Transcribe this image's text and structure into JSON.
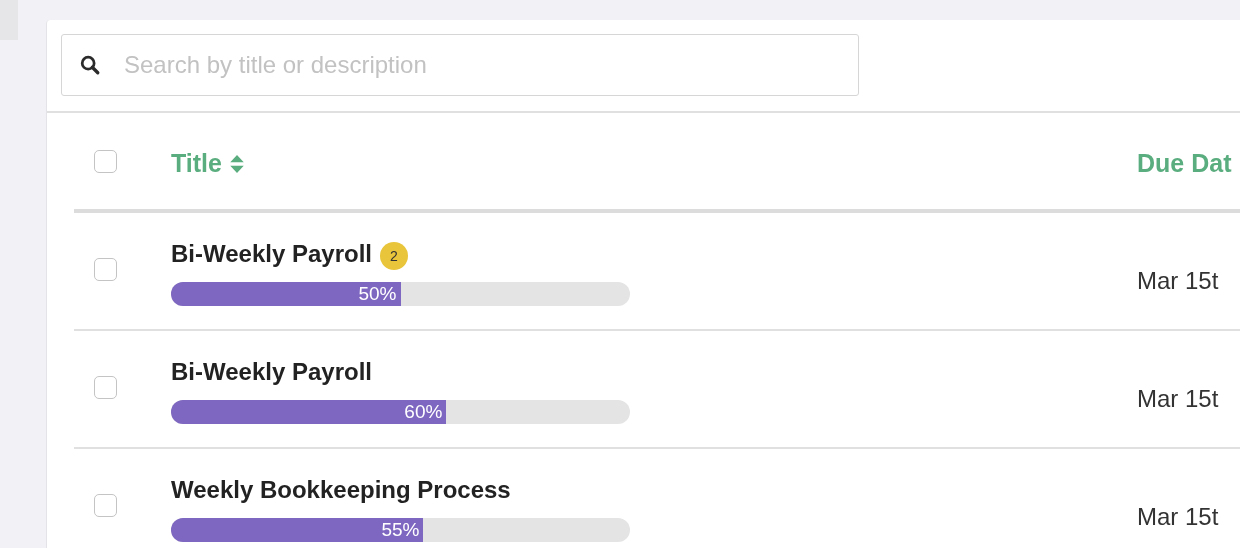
{
  "search": {
    "placeholder": "Search by title or description"
  },
  "header": {
    "checked": false,
    "columns": [
      {
        "label": "Title",
        "sortable": true
      },
      {
        "label": "Due Dat",
        "sortable": false
      }
    ]
  },
  "rows": [
    {
      "checked": false,
      "title": "Bi-Weekly Payroll",
      "badge": "2",
      "level": 0.5,
      "percent": "50%",
      "due": "Mar 15t"
    },
    {
      "checked": false,
      "title": "Bi-Weekly Payroll",
      "level": 0.6,
      "percent": "60%",
      "due": "Mar 15t"
    },
    {
      "checked": false,
      "title": "Weekly Bookkeeping Process",
      "level": 0.55,
      "percent": "55%",
      "due": "Mar 15t"
    }
  ]
}
